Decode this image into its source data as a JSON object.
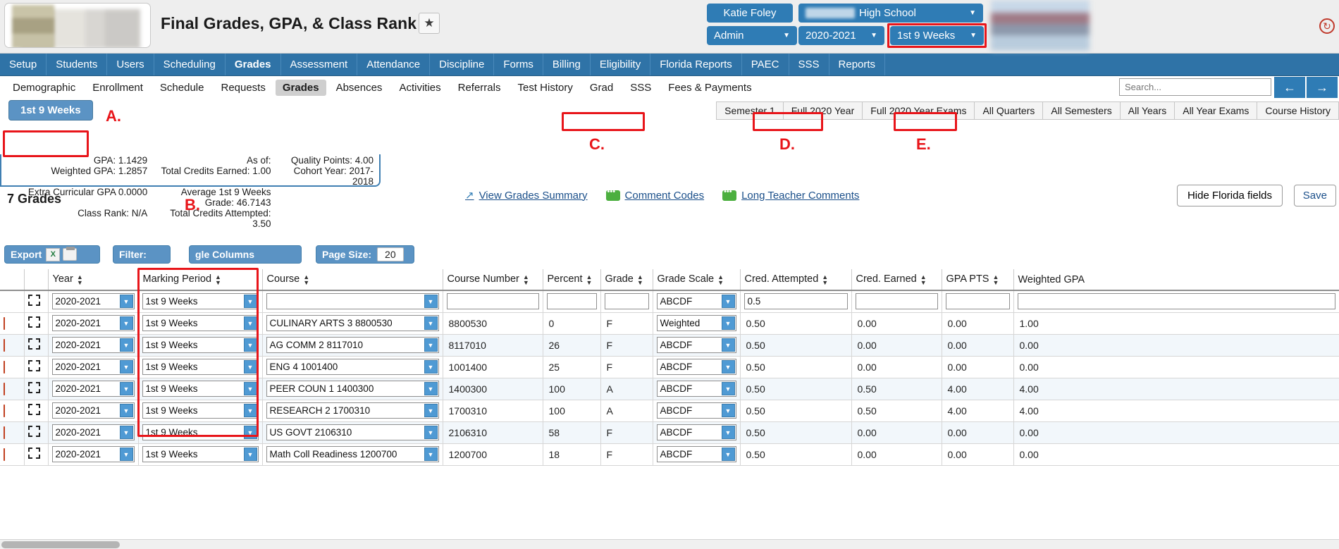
{
  "header": {
    "title": "Final Grades, GPA, & Class Rank",
    "star_icon": "★",
    "user_button": "Katie Foley",
    "school_button": "High School",
    "role_button": "Admin",
    "year_button": "2020-2021",
    "marking_period_button": "1st 9 Weeks",
    "caret": "▼",
    "refresh_icon": "↻"
  },
  "main_nav": {
    "items": [
      {
        "label": "Setup",
        "active": false
      },
      {
        "label": "Students",
        "active": false
      },
      {
        "label": "Users",
        "active": false
      },
      {
        "label": "Scheduling",
        "active": false
      },
      {
        "label": "Grades",
        "active": true
      },
      {
        "label": "Assessment",
        "active": false
      },
      {
        "label": "Attendance",
        "active": false
      },
      {
        "label": "Discipline",
        "active": false
      },
      {
        "label": "Forms",
        "active": false
      },
      {
        "label": "Billing",
        "active": false
      },
      {
        "label": "Eligibility",
        "active": false
      },
      {
        "label": "Florida Reports",
        "active": false
      },
      {
        "label": "PAEC",
        "active": false
      },
      {
        "label": "SSS",
        "active": false
      },
      {
        "label": "Reports",
        "active": false
      }
    ]
  },
  "sub_nav": {
    "items": [
      {
        "label": "Demographic",
        "active": false
      },
      {
        "label": "Enrollment",
        "active": false
      },
      {
        "label": "Schedule",
        "active": false
      },
      {
        "label": "Requests",
        "active": false
      },
      {
        "label": "Grades",
        "active": true
      },
      {
        "label": "Absences",
        "active": false
      },
      {
        "label": "Activities",
        "active": false
      },
      {
        "label": "Referrals",
        "active": false
      },
      {
        "label": "Test History",
        "active": false
      },
      {
        "label": "Grad",
        "active": false
      },
      {
        "label": "SSS",
        "active": false
      },
      {
        "label": "Fees & Payments",
        "active": false
      }
    ],
    "search_placeholder": "Search...",
    "arrow_left": "←",
    "arrow_right": "→"
  },
  "mp_strip": {
    "active_tab": "1st 9 Weeks",
    "tabs": [
      {
        "label": "Semester 1",
        "highlight": false
      },
      {
        "label": "Full 2020 Year",
        "highlight": true
      },
      {
        "label": "Full 2020 Year Exams",
        "highlight": false
      },
      {
        "label": "All Quarters",
        "highlight": true
      },
      {
        "label": "All Semesters",
        "highlight": false
      },
      {
        "label": "All Years",
        "highlight": true
      },
      {
        "label": "All Year Exams",
        "highlight": false
      },
      {
        "label": "Course History",
        "highlight": false
      }
    ]
  },
  "annotations": [
    {
      "id": "A",
      "label": "A."
    },
    {
      "id": "B",
      "label": "B."
    },
    {
      "id": "C",
      "label": "C."
    },
    {
      "id": "D",
      "label": "D."
    },
    {
      "id": "E",
      "label": "E."
    }
  ],
  "gpa_box": {
    "rows": [
      {
        "c1": "GPA: 1.1429",
        "c2": "As of:",
        "c3": "Quality Points: 4.00"
      },
      {
        "c1": "Weighted GPA: 1.2857",
        "c2": "Total Credits Earned: 1.00",
        "c3": "Cohort Year: 2017-2018"
      },
      {
        "c1": "Extra Curricular GPA 0.0000",
        "c2": "Average 1st 9 Weeks Grade: 46.7143",
        "c3": ""
      },
      {
        "c1": "Class Rank: N/A",
        "c2": "Total Credits Attempted: 3.50",
        "c3": ""
      }
    ]
  },
  "grades_bar": {
    "count_label": "7 Grades",
    "view_summary": "View Grades Summary",
    "comment_codes": "Comment Codes",
    "long_comments": "Long Teacher Comments",
    "hide_florida": "Hide Florida fields",
    "save": "Save",
    "external_icon": "↗"
  },
  "toolbar": {
    "export": "Export",
    "excel_icon": "X",
    "print_icon": "printer-icon",
    "filter": "Filter:",
    "toggle_columns": "gle Columns",
    "page_size_label": "Page Size:",
    "page_size_value": "20"
  },
  "table": {
    "columns": [
      "Year",
      "Marking Period",
      "Course",
      "Course Number",
      "Percent",
      "Grade",
      "Grade Scale",
      "Cred. Attempted",
      "Cred. Earned",
      "GPA PTS",
      "Weighted GPA"
    ],
    "sort_icon": "⬍",
    "filter_row": {
      "year": "2020-2021",
      "marking_period": "1st 9 Weeks",
      "course": "",
      "course_number": "",
      "percent": "",
      "grade": "",
      "grade_scale": "ABCDF",
      "cred_attempted": "0.5",
      "cred_earned": "",
      "gpa_pts": "",
      "weighted_gpa": ""
    },
    "rows": [
      {
        "year": "2020-2021",
        "marking_period": "1st 9 Weeks",
        "course": "CULINARY ARTS 3 8800530",
        "course_number": "8800530",
        "percent": "0",
        "grade": "F",
        "grade_scale": "Weighted",
        "cred_attempted": "0.50",
        "cred_earned": "0.00",
        "gpa_pts": "0.00",
        "weighted_gpa": "1.00"
      },
      {
        "year": "2020-2021",
        "marking_period": "1st 9 Weeks",
        "course": "AG COMM 2 8117010",
        "course_number": "8117010",
        "percent": "26",
        "grade": "F",
        "grade_scale": "ABCDF",
        "cred_attempted": "0.50",
        "cred_earned": "0.00",
        "gpa_pts": "0.00",
        "weighted_gpa": "0.00"
      },
      {
        "year": "2020-2021",
        "marking_period": "1st 9 Weeks",
        "course": "ENG 4 1001400",
        "course_number": "1001400",
        "percent": "25",
        "grade": "F",
        "grade_scale": "ABCDF",
        "cred_attempted": "0.50",
        "cred_earned": "0.00",
        "gpa_pts": "0.00",
        "weighted_gpa": "0.00"
      },
      {
        "year": "2020-2021",
        "marking_period": "1st 9 Weeks",
        "course": "PEER COUN 1 1400300",
        "course_number": "1400300",
        "percent": "100",
        "grade": "A",
        "grade_scale": "ABCDF",
        "cred_attempted": "0.50",
        "cred_earned": "0.50",
        "gpa_pts": "4.00",
        "weighted_gpa": "4.00"
      },
      {
        "year": "2020-2021",
        "marking_period": "1st 9 Weeks",
        "course": "RESEARCH 2 1700310",
        "course_number": "1700310",
        "percent": "100",
        "grade": "A",
        "grade_scale": "ABCDF",
        "cred_attempted": "0.50",
        "cred_earned": "0.50",
        "gpa_pts": "4.00",
        "weighted_gpa": "4.00"
      },
      {
        "year": "2020-2021",
        "marking_period": "1st 9 Weeks",
        "course": "US GOVT 2106310",
        "course_number": "2106310",
        "percent": "58",
        "grade": "F",
        "grade_scale": "ABCDF",
        "cred_attempted": "0.50",
        "cred_earned": "0.00",
        "gpa_pts": "0.00",
        "weighted_gpa": "0.00"
      },
      {
        "year": "2020-2021",
        "marking_period": "1st 9 Weeks",
        "course": "Math Coll Readiness 1200700",
        "course_number": "1200700",
        "percent": "18",
        "grade": "F",
        "grade_scale": "ABCDF",
        "cred_attempted": "0.50",
        "cred_earned": "0.00",
        "gpa_pts": "0.00",
        "weighted_gpa": "0.00"
      }
    ]
  },
  "colors": {
    "nav_blue": "#2f73a7",
    "button_blue": "#2f7cb5",
    "tab_blue": "#5b93c4",
    "annotation_red": "#e8151a",
    "link_blue": "#1a4f8a",
    "row_alt": "#f2f7fb"
  }
}
